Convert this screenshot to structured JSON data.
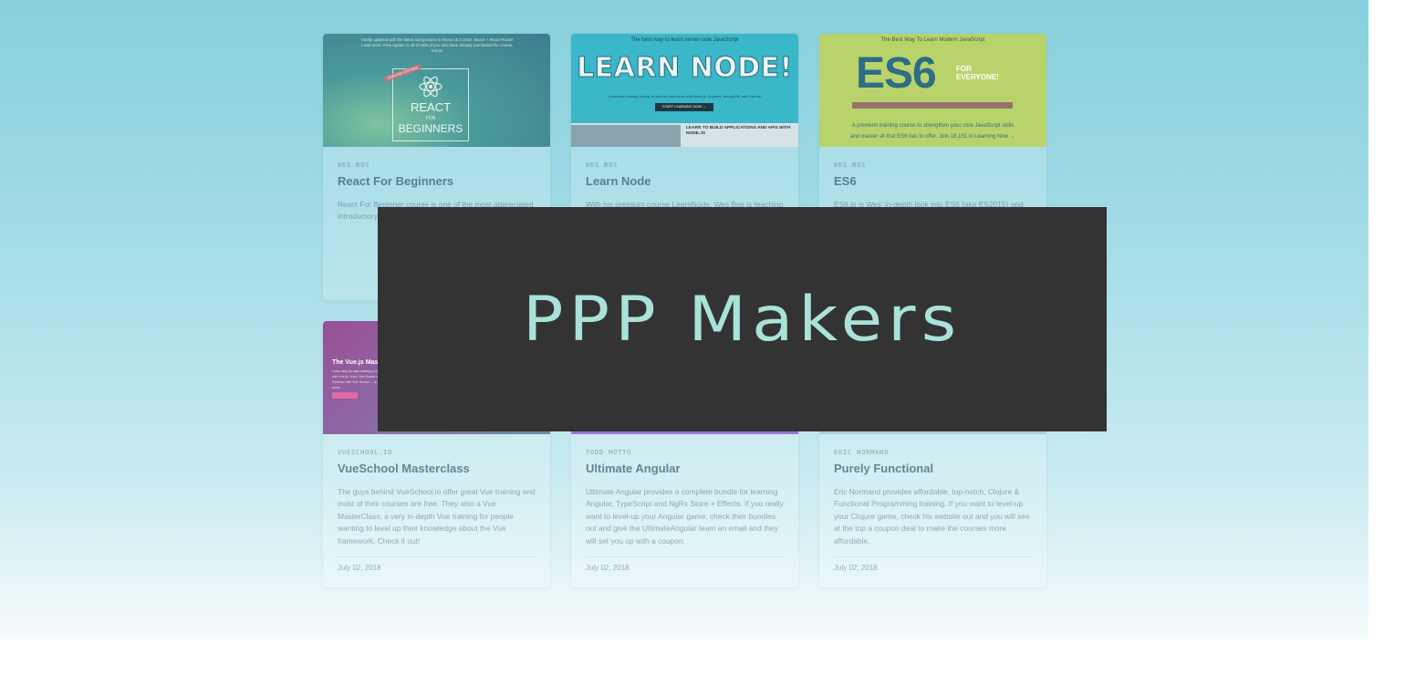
{
  "overlay": {
    "logo_text": "PPP Makers"
  },
  "cards": [
    {
      "author": "WES BOS",
      "title": "React For Beginners",
      "description": "React For Beginner course is one of the most appreciated introductory... For Beginne... are junior-le...",
      "date": "",
      "thumb": {
        "note": "Totally updated with the latest and greatest in React 16.3 2018. Watch + React Router 4 and more. Free update to all 27,000 of you who have already purchased the course. Enjoy!",
        "ribbon": "UPDATED FOR 2018",
        "word1": "REACT",
        "word2": "FOR",
        "word3": "BEGINNERS"
      }
    },
    {
      "author": "WES BOS",
      "title": "Learn Node",
      "description": "With his premium course LearnNode, Wes Bos is teaching",
      "date": "",
      "thumb": {
        "top": "The best way to learn server-side JavaScript",
        "big": "LEARN NODE!",
        "sub": "A premium training course to learn to build apps with Node.js, Express, MongoDB, and Friends.",
        "button": "START LEARNING NOW →",
        "lower": "LEARN TO BUILD APPLICATIONS AND APIS WITH NODE.JS"
      }
    },
    {
      "author": "WES BOS",
      "title": "ES6",
      "description": "ES6.io is Wes' in-depth look into ES6 (aka ES2015) and",
      "date": "",
      "thumb": {
        "top": "The Best Way To Learn Modern JavaScript",
        "big": "ES6",
        "for": "FOR EVERYONE!",
        "line1": "A premium training course to strengthen your core JavaScript skills",
        "line2": "and master all that ES6 has to offer. Join 18,151 in Learning Now →"
      }
    },
    {
      "author": "VUESCHOOL.IO",
      "title": "VueSchool Masterclass",
      "description": "The guys behind VueSchool.io offer great Vue training and most of their courses are free. They also a Vue MasterClass, a very in-depth Vue training for people wanting to level up their knowledge about the Vue framework. Check it out!",
      "date": "July 02, 2018",
      "thumb": {
        "heading": "The Vue.js Mas",
        "para": "Learn step by step building a real app with Vue.js, Vuex, Vue Router and Firebase with Vue School — a real world ..."
      }
    },
    {
      "author": "TODD MOTTO",
      "title": "Ultimate Angular",
      "description": "Ultimate Angular provides a complete bundle for learning Angular, TypeScript and NgRx Store + Effects. If you really want to level-up your Angular game, check their bundles out and give the UltimateAngular team an email and they will set you up with a coupon.",
      "date": "July 02, 2018"
    },
    {
      "author": "ERIC NORMAND",
      "title": "Purely Functional",
      "description": "Eric Normand provides affordable, top-notch, Clojure & Functional Programming training. If you want to level-up your Clojure game, check his website out and you will see at the top a coupon deal to make the courses more affordable.",
      "date": "July 02, 2018"
    }
  ],
  "colors": {
    "overlay_bg": "#333333",
    "logo": "#a9e2d8",
    "bg_top": "#87cfdd",
    "bg_bottom": "#f6fbfc"
  }
}
